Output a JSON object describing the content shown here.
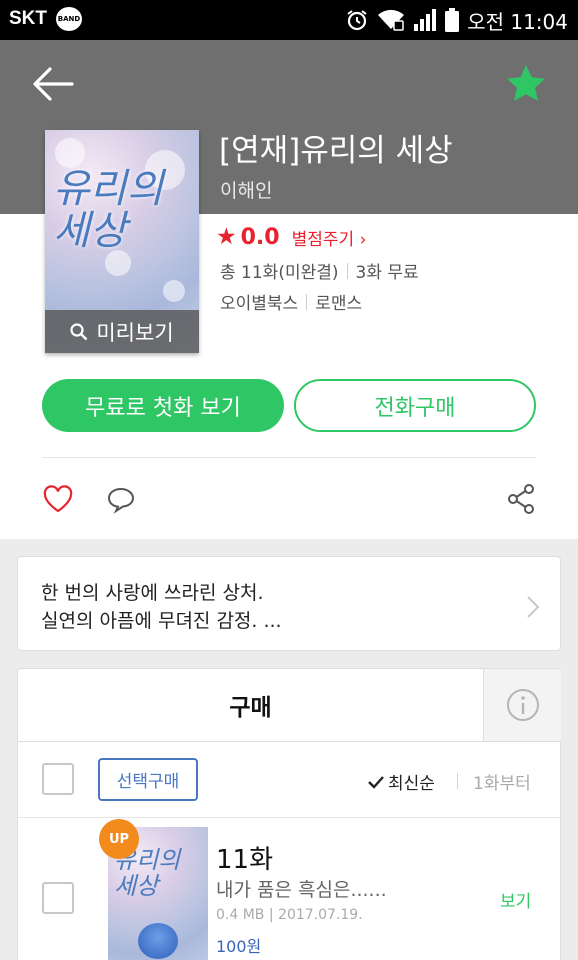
{
  "status_bar": {
    "carrier": "SKT",
    "band": "BAND",
    "time": "오전 11:04"
  },
  "book": {
    "title": "[연재]유리의 세상",
    "author": "이해인",
    "cover_title": "유리의\n세상",
    "preview_label": "미리보기",
    "rating": "0.0",
    "rate_link": "별점주기",
    "episodes_info": "총 11화(미완결)",
    "free_info": "3화 무료",
    "publisher": "오이별북스",
    "genre": "로맨스"
  },
  "actions": {
    "read_free": "무료로 첫화 보기",
    "buy_all": "전화구매"
  },
  "synopsis": {
    "line1": "한 번의 사랑에 쓰라린 상처.",
    "line2": "실연의 아픔에 무뎌진 감정. ..."
  },
  "purchase": {
    "tab_label": "구매",
    "select_buy": "선택구매",
    "sort_latest": "최신순",
    "sort_first": "1화부터"
  },
  "episode": {
    "badge": "UP",
    "number": "11화",
    "desc": "내가 품은 흑심은......",
    "size": "0.4 MB",
    "date": "2017.07.19.",
    "price": "100원",
    "view_label": "보기"
  },
  "colors": {
    "accent_green": "#2fc766",
    "rating_red": "#e8232f",
    "header_gray": "#6f6f6f",
    "link_blue": "#4a76c2",
    "badge_orange": "#f28a1c"
  }
}
